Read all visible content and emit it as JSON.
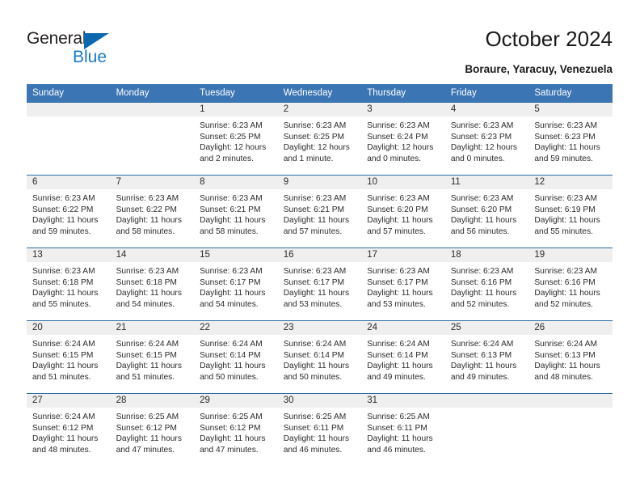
{
  "brand": {
    "name_part1": "General",
    "name_part2": "Blue"
  },
  "header": {
    "title": "October 2024",
    "location": "Boraure, Yaracuy, Venezuela"
  },
  "colors": {
    "header_blue": "#3b75b3",
    "row_rule_blue": "#2e6da4",
    "daynum_bg": "#efefef",
    "logo_blue": "#1b7ac4",
    "text": "#2b2b2b"
  },
  "weekday_headers": [
    "Sunday",
    "Monday",
    "Tuesday",
    "Wednesday",
    "Thursday",
    "Friday",
    "Saturday"
  ],
  "labels": {
    "sunrise": "Sunrise:",
    "sunset": "Sunset:",
    "daylight": "Daylight:"
  },
  "weeks": [
    [
      {
        "day": ""
      },
      {
        "day": ""
      },
      {
        "day": "1",
        "sunrise": "Sunrise: 6:23 AM",
        "sunset": "Sunset: 6:25 PM",
        "daylight1": "Daylight: 12 hours",
        "daylight2": "and 2 minutes."
      },
      {
        "day": "2",
        "sunrise": "Sunrise: 6:23 AM",
        "sunset": "Sunset: 6:25 PM",
        "daylight1": "Daylight: 12 hours",
        "daylight2": "and 1 minute."
      },
      {
        "day": "3",
        "sunrise": "Sunrise: 6:23 AM",
        "sunset": "Sunset: 6:24 PM",
        "daylight1": "Daylight: 12 hours",
        "daylight2": "and 0 minutes."
      },
      {
        "day": "4",
        "sunrise": "Sunrise: 6:23 AM",
        "sunset": "Sunset: 6:23 PM",
        "daylight1": "Daylight: 12 hours",
        "daylight2": "and 0 minutes."
      },
      {
        "day": "5",
        "sunrise": "Sunrise: 6:23 AM",
        "sunset": "Sunset: 6:23 PM",
        "daylight1": "Daylight: 11 hours",
        "daylight2": "and 59 minutes."
      }
    ],
    [
      {
        "day": "6",
        "sunrise": "Sunrise: 6:23 AM",
        "sunset": "Sunset: 6:22 PM",
        "daylight1": "Daylight: 11 hours",
        "daylight2": "and 59 minutes."
      },
      {
        "day": "7",
        "sunrise": "Sunrise: 6:23 AM",
        "sunset": "Sunset: 6:22 PM",
        "daylight1": "Daylight: 11 hours",
        "daylight2": "and 58 minutes."
      },
      {
        "day": "8",
        "sunrise": "Sunrise: 6:23 AM",
        "sunset": "Sunset: 6:21 PM",
        "daylight1": "Daylight: 11 hours",
        "daylight2": "and 58 minutes."
      },
      {
        "day": "9",
        "sunrise": "Sunrise: 6:23 AM",
        "sunset": "Sunset: 6:21 PM",
        "daylight1": "Daylight: 11 hours",
        "daylight2": "and 57 minutes."
      },
      {
        "day": "10",
        "sunrise": "Sunrise: 6:23 AM",
        "sunset": "Sunset: 6:20 PM",
        "daylight1": "Daylight: 11 hours",
        "daylight2": "and 57 minutes."
      },
      {
        "day": "11",
        "sunrise": "Sunrise: 6:23 AM",
        "sunset": "Sunset: 6:20 PM",
        "daylight1": "Daylight: 11 hours",
        "daylight2": "and 56 minutes."
      },
      {
        "day": "12",
        "sunrise": "Sunrise: 6:23 AM",
        "sunset": "Sunset: 6:19 PM",
        "daylight1": "Daylight: 11 hours",
        "daylight2": "and 55 minutes."
      }
    ],
    [
      {
        "day": "13",
        "sunrise": "Sunrise: 6:23 AM",
        "sunset": "Sunset: 6:18 PM",
        "daylight1": "Daylight: 11 hours",
        "daylight2": "and 55 minutes."
      },
      {
        "day": "14",
        "sunrise": "Sunrise: 6:23 AM",
        "sunset": "Sunset: 6:18 PM",
        "daylight1": "Daylight: 11 hours",
        "daylight2": "and 54 minutes."
      },
      {
        "day": "15",
        "sunrise": "Sunrise: 6:23 AM",
        "sunset": "Sunset: 6:17 PM",
        "daylight1": "Daylight: 11 hours",
        "daylight2": "and 54 minutes."
      },
      {
        "day": "16",
        "sunrise": "Sunrise: 6:23 AM",
        "sunset": "Sunset: 6:17 PM",
        "daylight1": "Daylight: 11 hours",
        "daylight2": "and 53 minutes."
      },
      {
        "day": "17",
        "sunrise": "Sunrise: 6:23 AM",
        "sunset": "Sunset: 6:17 PM",
        "daylight1": "Daylight: 11 hours",
        "daylight2": "and 53 minutes."
      },
      {
        "day": "18",
        "sunrise": "Sunrise: 6:23 AM",
        "sunset": "Sunset: 6:16 PM",
        "daylight1": "Daylight: 11 hours",
        "daylight2": "and 52 minutes."
      },
      {
        "day": "19",
        "sunrise": "Sunrise: 6:23 AM",
        "sunset": "Sunset: 6:16 PM",
        "daylight1": "Daylight: 11 hours",
        "daylight2": "and 52 minutes."
      }
    ],
    [
      {
        "day": "20",
        "sunrise": "Sunrise: 6:24 AM",
        "sunset": "Sunset: 6:15 PM",
        "daylight1": "Daylight: 11 hours",
        "daylight2": "and 51 minutes."
      },
      {
        "day": "21",
        "sunrise": "Sunrise: 6:24 AM",
        "sunset": "Sunset: 6:15 PM",
        "daylight1": "Daylight: 11 hours",
        "daylight2": "and 51 minutes."
      },
      {
        "day": "22",
        "sunrise": "Sunrise: 6:24 AM",
        "sunset": "Sunset: 6:14 PM",
        "daylight1": "Daylight: 11 hours",
        "daylight2": "and 50 minutes."
      },
      {
        "day": "23",
        "sunrise": "Sunrise: 6:24 AM",
        "sunset": "Sunset: 6:14 PM",
        "daylight1": "Daylight: 11 hours",
        "daylight2": "and 50 minutes."
      },
      {
        "day": "24",
        "sunrise": "Sunrise: 6:24 AM",
        "sunset": "Sunset: 6:14 PM",
        "daylight1": "Daylight: 11 hours",
        "daylight2": "and 49 minutes."
      },
      {
        "day": "25",
        "sunrise": "Sunrise: 6:24 AM",
        "sunset": "Sunset: 6:13 PM",
        "daylight1": "Daylight: 11 hours",
        "daylight2": "and 49 minutes."
      },
      {
        "day": "26",
        "sunrise": "Sunrise: 6:24 AM",
        "sunset": "Sunset: 6:13 PM",
        "daylight1": "Daylight: 11 hours",
        "daylight2": "and 48 minutes."
      }
    ],
    [
      {
        "day": "27",
        "sunrise": "Sunrise: 6:24 AM",
        "sunset": "Sunset: 6:12 PM",
        "daylight1": "Daylight: 11 hours",
        "daylight2": "and 48 minutes."
      },
      {
        "day": "28",
        "sunrise": "Sunrise: 6:25 AM",
        "sunset": "Sunset: 6:12 PM",
        "daylight1": "Daylight: 11 hours",
        "daylight2": "and 47 minutes."
      },
      {
        "day": "29",
        "sunrise": "Sunrise: 6:25 AM",
        "sunset": "Sunset: 6:12 PM",
        "daylight1": "Daylight: 11 hours",
        "daylight2": "and 47 minutes."
      },
      {
        "day": "30",
        "sunrise": "Sunrise: 6:25 AM",
        "sunset": "Sunset: 6:11 PM",
        "daylight1": "Daylight: 11 hours",
        "daylight2": "and 46 minutes."
      },
      {
        "day": "31",
        "sunrise": "Sunrise: 6:25 AM",
        "sunset": "Sunset: 6:11 PM",
        "daylight1": "Daylight: 11 hours",
        "daylight2": "and 46 minutes."
      },
      {
        "day": ""
      },
      {
        "day": ""
      }
    ]
  ]
}
